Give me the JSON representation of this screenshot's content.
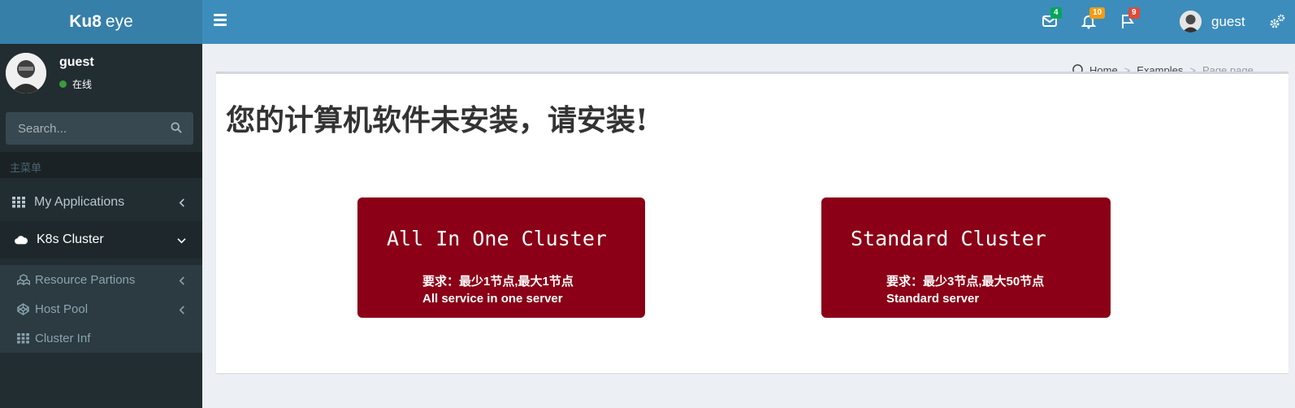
{
  "app": {
    "logo_bold": "Ku8",
    "logo_rest": "eye"
  },
  "header": {
    "mail_count": "4",
    "bell_count": "10",
    "flag_count": "9",
    "user_name": "guest",
    "colors": {
      "mail_badge": "#00a65a",
      "bell_badge": "#f39c12",
      "flag_badge": "#dd4b39"
    }
  },
  "sidebar": {
    "user_name": "guest",
    "status": "在线",
    "search_placeholder": "Search...",
    "header": "主菜单",
    "menu": [
      {
        "label": "My Applications",
        "icon": "grid-icon"
      },
      {
        "label": "K8s Cluster",
        "icon": "cloud-icon"
      }
    ],
    "submenu": [
      {
        "label": "Resource Partions",
        "icon": "cubes-icon"
      },
      {
        "label": "Host Pool",
        "icon": "codepen-icon"
      },
      {
        "label": "Cluster Inf",
        "icon": "grid-icon"
      }
    ]
  },
  "breadcrumb": {
    "home": "Home",
    "examples": "Examples",
    "current": "Page page"
  },
  "main": {
    "title": "您的计算机软件未安装，请安装!",
    "cards": [
      {
        "title": "All In One Cluster",
        "req": "要求：最少1节点,最大1节点",
        "desc": "All service in one server"
      },
      {
        "title": "Standard Cluster",
        "req": "要求：最少3节点,最大50节点",
        "desc": "Standard server"
      }
    ],
    "card_color": "#8b0016"
  }
}
